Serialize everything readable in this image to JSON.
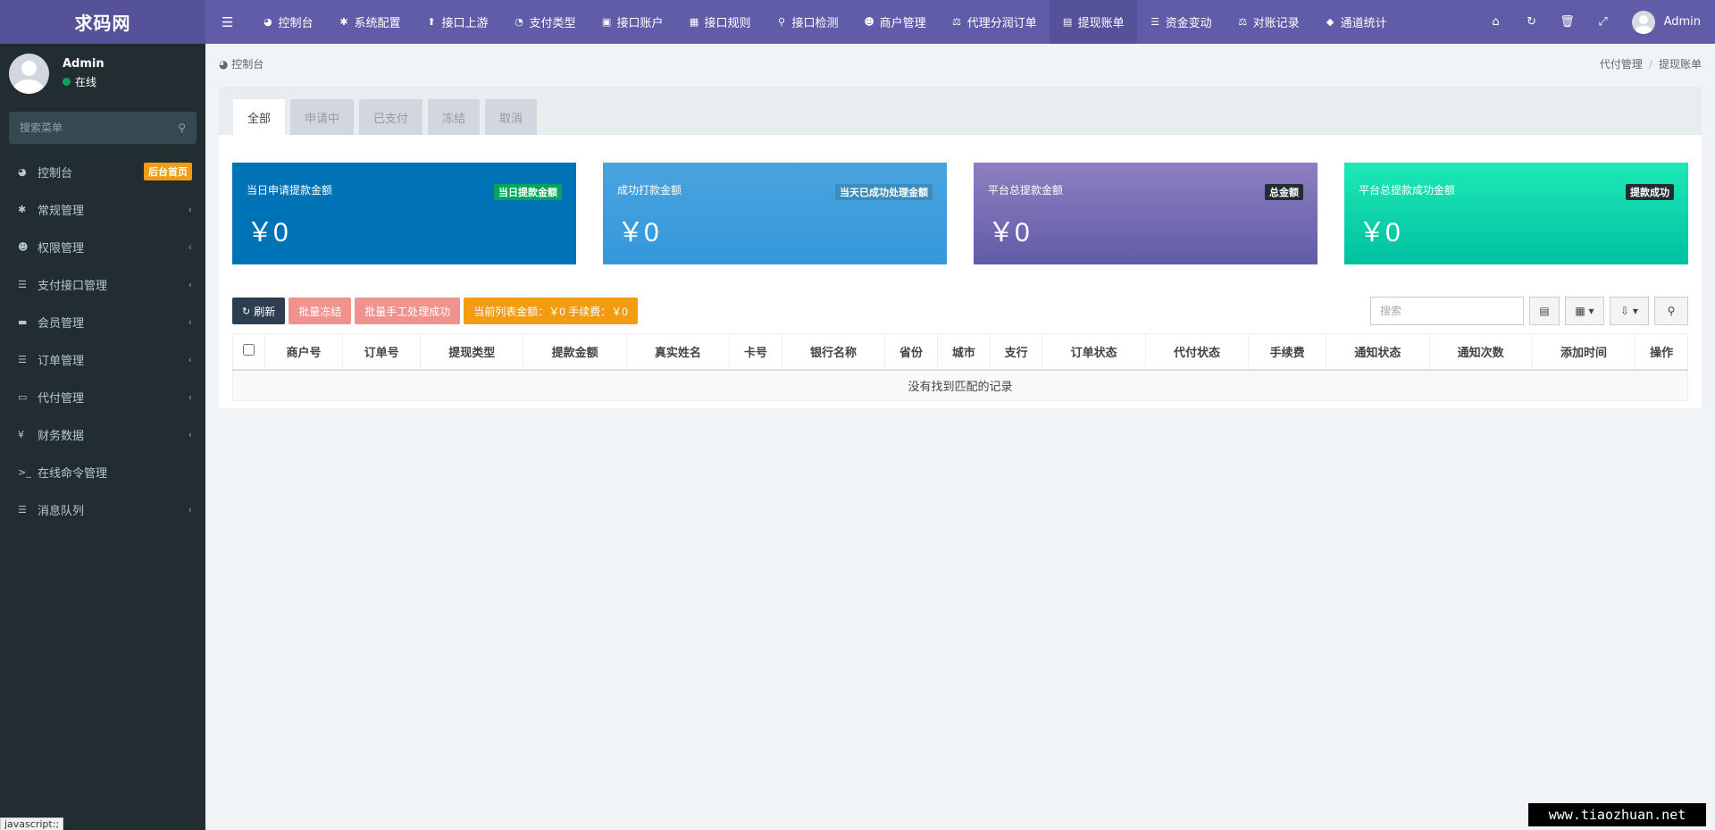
{
  "header": {
    "logo": "求码网",
    "nav": [
      {
        "icon": "dashboard-icon",
        "glyph": "◕",
        "label": "控制台"
      },
      {
        "icon": "gear-icon",
        "glyph": "✱",
        "label": "系统配置"
      },
      {
        "icon": "upload-icon",
        "glyph": "⬆",
        "label": "接口上游"
      },
      {
        "icon": "pie-icon",
        "glyph": "◔",
        "label": "支付类型"
      },
      {
        "icon": "account-icon",
        "glyph": "▣",
        "label": "接口账户"
      },
      {
        "icon": "qrcode-icon",
        "glyph": "▦",
        "label": "接口规则"
      },
      {
        "icon": "search-icon",
        "glyph": "⚲",
        "label": "接口检测"
      },
      {
        "icon": "user-icon",
        "glyph": "☻",
        "label": "商户管理"
      },
      {
        "icon": "balance-icon",
        "glyph": "⚖",
        "label": "代理分润订单"
      },
      {
        "icon": "card-icon",
        "glyph": "▤",
        "label": "提现账单"
      },
      {
        "icon": "list-icon",
        "glyph": "☰",
        "label": "资金变动"
      },
      {
        "icon": "balance-icon",
        "glyph": "⚖",
        "label": "对账记录"
      },
      {
        "icon": "diamond-icon",
        "glyph": "◆",
        "label": "通道统计"
      }
    ],
    "active_index": 9,
    "user": "Admin"
  },
  "sidebar": {
    "user_name": "Admin",
    "user_status": "在线",
    "search_placeholder": "搜索菜单",
    "items": [
      {
        "icon": "dashboard-icon",
        "glyph": "◕",
        "label": "控制台",
        "badge": "后台首页"
      },
      {
        "icon": "gears-icon",
        "glyph": "✱",
        "label": "常规管理",
        "arrow": "‹"
      },
      {
        "icon": "users-icon",
        "glyph": "☻",
        "label": "权限管理",
        "arrow": "‹"
      },
      {
        "icon": "list-icon",
        "glyph": "☰",
        "label": "支付接口管理",
        "arrow": "‹"
      },
      {
        "icon": "card-icon",
        "glyph": "▬",
        "label": "会员管理",
        "arrow": "‹"
      },
      {
        "icon": "list-icon",
        "glyph": "☰",
        "label": "订单管理",
        "arrow": "‹"
      },
      {
        "icon": "money-icon",
        "glyph": "▭",
        "label": "代付管理",
        "arrow": "‹"
      },
      {
        "icon": "yen-icon",
        "glyph": "¥",
        "label": "财务数据",
        "arrow": "‹"
      },
      {
        "icon": "terminal-icon",
        "glyph": ">_",
        "label": "在线命令管理"
      },
      {
        "icon": "list-icon",
        "glyph": "☰",
        "label": "消息队列",
        "arrow": "‹"
      }
    ]
  },
  "breadcrumb": {
    "left": "控制台",
    "parent": "代付管理",
    "current": "提现账单"
  },
  "tabs": [
    "全部",
    "申请中",
    "已支付",
    "冻结",
    "取消"
  ],
  "cards": [
    {
      "title": "当日申请提款金额",
      "tag": "当日提款金额",
      "value": "￥0",
      "bg": "#0073b7",
      "tag_bg": "#00a65a"
    },
    {
      "title": "成功打款金额",
      "tag": "当天已成功处理金额",
      "value": "￥0",
      "bg": "#3c8dbc",
      "tag_bg": "#3c8dbc"
    },
    {
      "title": "平台总提款金额",
      "tag": "总金额",
      "value": "￥0",
      "bg": "#605ca8",
      "tag_bg": "#222d32"
    },
    {
      "title": "平台总提款成功金额",
      "tag": "提款成功",
      "value": "￥0",
      "bg": "#00c0a0",
      "tag_bg": "#222d32"
    }
  ],
  "toolbar": {
    "refresh": "刷新",
    "batch_freeze": "批量冻结",
    "batch_manual": "批量手工处理成功",
    "summary": "当前列表金额：￥0  手续费：￥0",
    "search_placeholder": "搜索"
  },
  "table": {
    "columns": [
      "商户号",
      "订单号",
      "提现类型",
      "提款金额",
      "真实姓名",
      "卡号",
      "银行名称",
      "省份",
      "城市",
      "支行",
      "订单状态",
      "代付状态",
      "手续费",
      "通知状态",
      "通知次数",
      "添加时间",
      "操作"
    ],
    "empty": "没有找到匹配的记录"
  },
  "status_tip": "javascript:;",
  "watermark": "www.tiaozhuan.net"
}
